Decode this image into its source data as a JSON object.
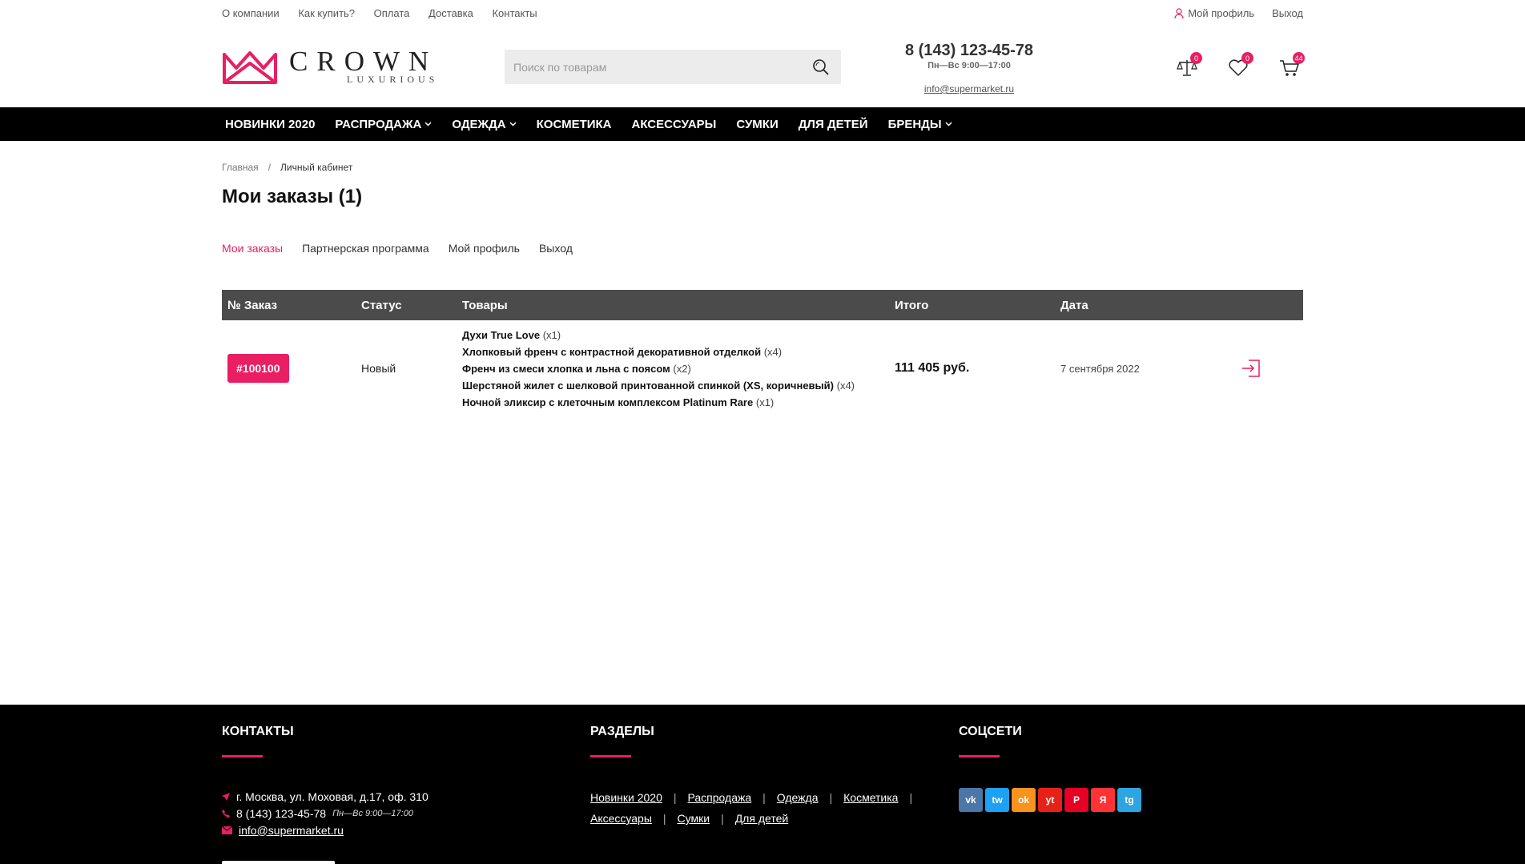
{
  "topbar": {
    "links": [
      "О компании",
      "Как купить?",
      "Оплата",
      "Доставка",
      "Контакты"
    ],
    "profile": "Мой профиль",
    "logout": "Выход"
  },
  "header": {
    "brand": "CROWN",
    "brand_sub": "LUXURIOUS",
    "search_placeholder": "Поиск по товарам",
    "phone": "8 (143) 123-45-78",
    "hours": "Пн—Вс 9:00—17:00",
    "email": "info@supermarket.ru",
    "compare_count": "0",
    "wishlist_count": "0",
    "cart_count": "44"
  },
  "nav": {
    "items": [
      {
        "label": "НОВИНКИ 2020"
      },
      {
        "label": "РАСПРОДАЖА"
      },
      {
        "label": "ОДЕЖДА"
      },
      {
        "label": "КОСМЕТИКА"
      },
      {
        "label": "АКСЕССУАРЫ"
      },
      {
        "label": "СУМКИ"
      },
      {
        "label": "ДЛЯ ДЕТЕЙ"
      },
      {
        "label": "БРЕНДЫ"
      }
    ]
  },
  "breadcrumb": {
    "home": "Главная",
    "sep": "/",
    "current": "Личный кабинет"
  },
  "page_title": "Мои заказы (1)",
  "tabs": [
    "Мои заказы",
    "Партнерская программа",
    "Мой профиль",
    "Выход"
  ],
  "table": {
    "headers": [
      "№ Заказ",
      "Статус",
      "Товары",
      "Итого",
      "Дата"
    ],
    "rows": [
      {
        "order": "#100100",
        "status": "Новый",
        "goods": [
          {
            "name": "Духи True Love",
            "qty": "(x1)"
          },
          {
            "name": "Хлопковый френч с контрастной декоративной отделкой",
            "qty": "(x4)"
          },
          {
            "name": "Френч из смеси хлопка и льна с поясом",
            "qty": "(x2)"
          },
          {
            "name": "Шерстяной жилет с шелковой принтованной спинкой (XS, коричневый)",
            "qty": "(x4)"
          },
          {
            "name": "Ночной эликсир с клеточным комплексом Platinum Rare",
            "qty": "(x1)"
          }
        ],
        "total": "111 405 руб.",
        "date": "7 сентября 2022"
      }
    ]
  },
  "footer": {
    "contacts_title": "КОНТАКТЫ",
    "address": "г. Москва, ул. Моховая, д.17, оф. 310",
    "phone": "8 (143) 123-45-78",
    "hours": "Пн—Вс 9:00—17:00",
    "email": "info@supermarket.ru",
    "sections_title": "РАЗДЕЛЫ",
    "sections": [
      "Новинки 2020",
      "Распродажа",
      "Одежда",
      "Косметика",
      "Аксессуары",
      "Сумки",
      "Для детей"
    ],
    "socials_title": "СОЦСЕТИ",
    "socials": [
      {
        "label": "vk",
        "color": "#4a76a8"
      },
      {
        "label": "tw",
        "color": "#1da1f2"
      },
      {
        "label": "ok",
        "color": "#f7931e"
      },
      {
        "label": "yt",
        "color": "#e62117"
      },
      {
        "label": "P",
        "color": "#e60023"
      },
      {
        "label": "Я",
        "color": "#f33"
      },
      {
        "label": "tg",
        "color": "#2ca5e0"
      }
    ]
  },
  "colors": {
    "accent": "#e91e63",
    "nav_bg": "#000000",
    "table_head": "#4b4b4b"
  }
}
